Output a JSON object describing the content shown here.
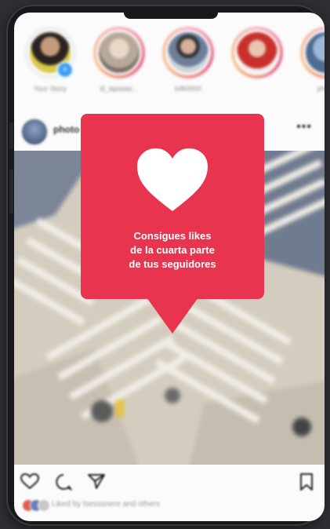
{
  "colors": {
    "accent": "#e8344f",
    "story_ring": "#e35f83",
    "background": "#2e2f33"
  },
  "stories": [
    {
      "name": "Your Story",
      "has_ring": false,
      "add_badge": true
    },
    {
      "name": "lil_lapislaz...",
      "has_ring": true
    },
    {
      "name": "lofti0000",
      "has_ring": true
    },
    {
      "name": "",
      "has_ring": true
    },
    {
      "name": "photo",
      "has_ring": true
    }
  ],
  "post": {
    "username": "photo",
    "more_icon": "more-dots-icon",
    "liked_by": "Liked by lsesssnere and others"
  },
  "actions": {
    "icons": [
      "heart-icon",
      "comment-icon",
      "share-icon",
      "bookmark-icon"
    ]
  },
  "callout": {
    "icon": "heart-icon",
    "lines": [
      "Consigues likes",
      "de la cuarta parte",
      "de tus seguidores"
    ]
  }
}
